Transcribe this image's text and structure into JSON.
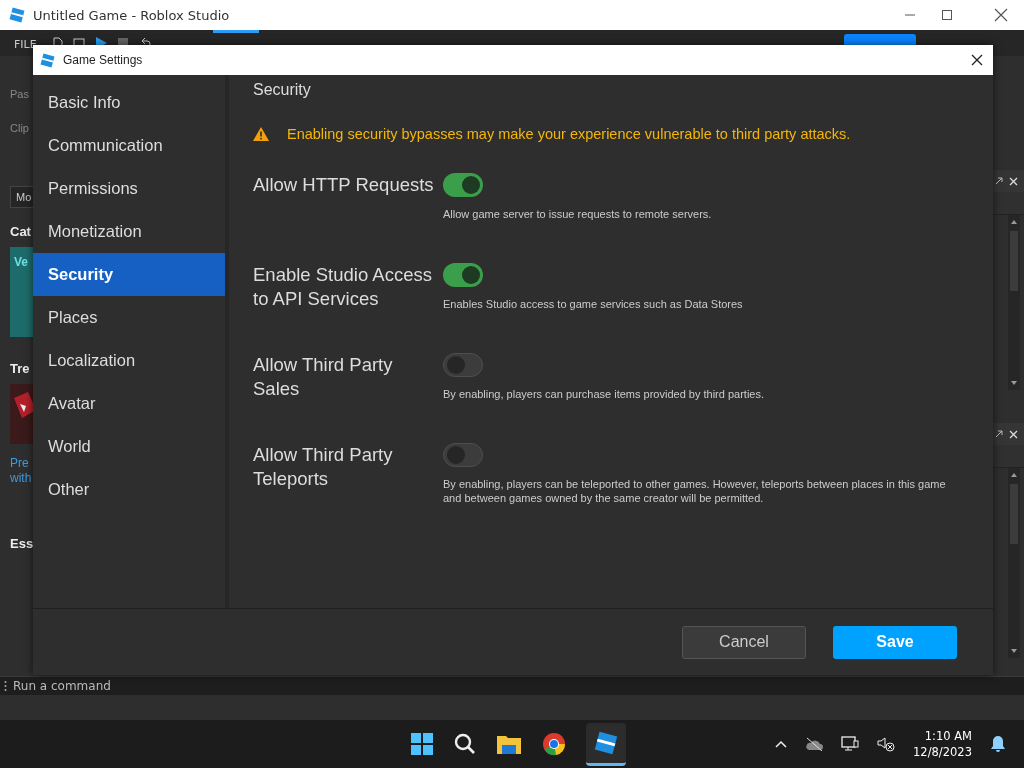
{
  "app_window": {
    "title": "Untitled Game - Roblox Studio"
  },
  "ribbon": {
    "file_menu": "FILE"
  },
  "left_panel": {
    "items": [
      {
        "kind": "label",
        "text": "Pas"
      },
      {
        "kind": "label",
        "text": "Clip"
      },
      {
        "kind": "field",
        "text": "Mo"
      },
      {
        "kind": "heading",
        "text": "Cat"
      },
      {
        "kind": "card",
        "text": "Ve"
      },
      {
        "kind": "heading",
        "text": "Tre"
      },
      {
        "kind": "thumb"
      },
      {
        "kind": "link",
        "text": "Pre"
      },
      {
        "kind": "link",
        "text": "with"
      },
      {
        "kind": "heading",
        "text": "Ess"
      }
    ]
  },
  "command_bar": {
    "placeholder": "Run a command"
  },
  "dialog": {
    "title": "Game Settings",
    "nav": [
      {
        "label": "Basic Info",
        "selected": false
      },
      {
        "label": "Communication",
        "selected": false
      },
      {
        "label": "Permissions",
        "selected": false
      },
      {
        "label": "Monetization",
        "selected": false
      },
      {
        "label": "Security",
        "selected": true
      },
      {
        "label": "Places",
        "selected": false
      },
      {
        "label": "Localization",
        "selected": false
      },
      {
        "label": "Avatar",
        "selected": false
      },
      {
        "label": "World",
        "selected": false
      },
      {
        "label": "Other",
        "selected": false
      }
    ],
    "section_title": "Security",
    "warning": "Enabling security bypasses may make your experience vulnerable to third party attacks.",
    "settings": [
      {
        "label": "Allow HTTP Requests",
        "on": true,
        "description": "Allow game server to issue requests to remote servers."
      },
      {
        "label": "Enable Studio Access to API Services",
        "on": true,
        "description": "Enables Studio access to game services such as Data Stores"
      },
      {
        "label": "Allow Third Party Sales",
        "on": false,
        "description": "By enabling, players can purchase items provided by third parties."
      },
      {
        "label": "Allow Third Party Teleports",
        "on": false,
        "description": "By enabling, players can be teleported to other games. However, teleports between places in this game and between games owned by the same creator will be permitted."
      }
    ],
    "cancel_button": "Cancel",
    "save_button": "Save"
  },
  "taskbar": {
    "time": "1:10 AM",
    "date": "12/8/2023"
  }
}
